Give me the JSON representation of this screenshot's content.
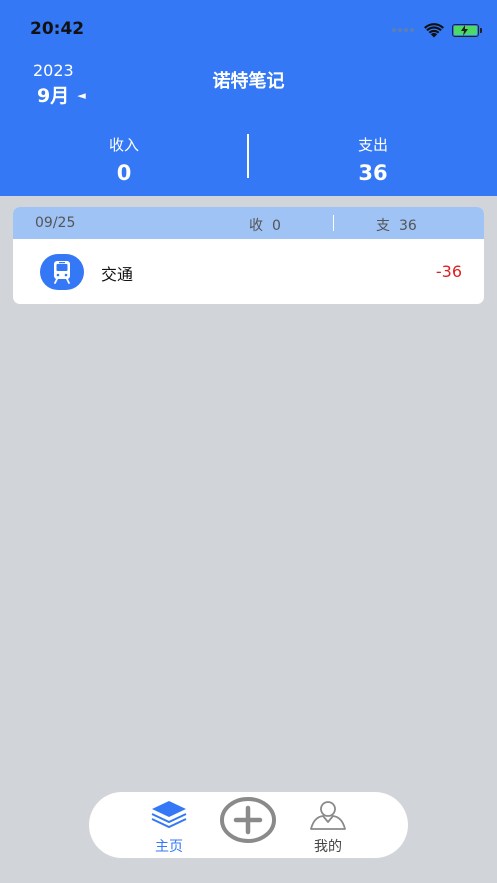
{
  "status_bar": {
    "time": "20:42"
  },
  "header": {
    "year": "2023",
    "month": "9月",
    "month_arrow": "◄",
    "title": "诺特笔记",
    "income_label": "收入",
    "income_value": "0",
    "expense_label": "支出",
    "expense_value": "36"
  },
  "day_group": {
    "date": "09/25",
    "income_label": "收",
    "income_value": "0",
    "expense_label": "支",
    "expense_value": "36",
    "entries": [
      {
        "icon": "bus-icon",
        "name": "交通",
        "amount": "-36"
      }
    ]
  },
  "tabbar": {
    "home_label": "主页",
    "mine_label": "我的"
  },
  "colors": {
    "primary": "#3478f6",
    "header_band": "#9fc3f5",
    "expense": "#e02020",
    "background": "#d1d4d8"
  }
}
